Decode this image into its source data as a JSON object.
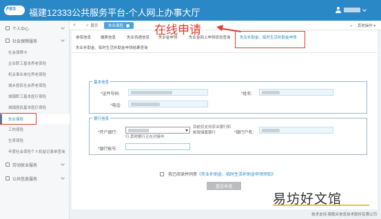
{
  "header": {
    "logo_text": "FBS",
    "title": "福建12333公共服务平台-个人网上办事大厅"
  },
  "tabbar": {
    "home": "首页",
    "current": "失业保险",
    "right": "其他操作"
  },
  "sidebar": {
    "items": [
      {
        "label": "个人中心",
        "kind": "group"
      },
      {
        "label": "社会保障服务",
        "kind": "group"
      },
      {
        "label": "社会保障卡",
        "kind": "sub"
      },
      {
        "label": "企业职工基本养老保险",
        "kind": "sub"
      },
      {
        "label": "机关事业单位养老保险",
        "kind": "sub"
      },
      {
        "label": "城乡居民社会养老保险",
        "kind": "sub"
      },
      {
        "label": "城镇职工基本医疗保险",
        "kind": "sub"
      },
      {
        "label": "城镇居民基本医疗保险",
        "kind": "sub"
      },
      {
        "label": "失业保险",
        "kind": "sub",
        "active": true
      },
      {
        "label": "工伤保险",
        "kind": "sub"
      },
      {
        "label": "生育保险",
        "kind": "sub"
      },
      {
        "label": "年度社会保险个人权益记录单查询",
        "kind": "sub"
      },
      {
        "label": "劳动就业服务",
        "kind": "group"
      },
      {
        "label": "公共信息服务",
        "kind": "group"
      }
    ]
  },
  "subtabs": {
    "row1": [
      "参保信息",
      "缴费信息",
      "失业待遇信息",
      "失业金申领",
      "失业金网上申领状态查询",
      "失业补助金、临时生活补助金申领"
    ],
    "row2": "失业补助金、临时生活补助金申领结果查询"
  },
  "annotation": "在线申请",
  "basic_info": {
    "title": "基本信息",
    "id_label": "*证件号码:",
    "name_label": "*姓名:",
    "phone_label": "*电话:"
  },
  "bank_info": {
    "title": "银行信息",
    "bank_label": "*开户银行:",
    "bank_note": "目前仅支持农业银行和邮政储蓄银行",
    "bank_note2": "行,其他银行正在对接中",
    "account_name_label": "*银行户名:",
    "account_no_label": "*银行账号:"
  },
  "agreement": {
    "prefix": "我已阅读并同意",
    "link": "《失业补助金、临时生活补助金申领须知》"
  },
  "submit_label": "提交申请",
  "footer": "技术支持:易联众信息技术股份有限公司",
  "watermark": "易坊好文馆",
  "colors": {
    "brand": "#2a88c7",
    "highlight": "#e23b2f"
  }
}
